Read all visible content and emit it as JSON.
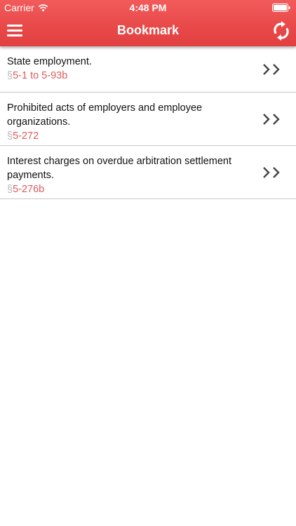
{
  "status_bar": {
    "carrier": "Carrier",
    "time": "4:48 PM",
    "wifi_icon": "wifi-icon",
    "battery_icon": "battery-icon"
  },
  "nav_bar": {
    "title": "Bookmark",
    "menu_icon": "hamburger-menu-icon",
    "refresh_icon": "refresh-icon"
  },
  "colors": {
    "header_red": "#e84848",
    "section_red": "#e05a5a",
    "section_mark_gray": "#b8b8b8",
    "chevron_gray": "#444444"
  },
  "bookmarks": [
    {
      "title": "State employment.",
      "section_mark": "§",
      "section": "5-1 to 5-93b",
      "chevron_icon": "double-chevron-right-icon"
    },
    {
      "title": "Prohibited acts of employers and employee organizations.",
      "section_mark": "§",
      "section": "5-272",
      "chevron_icon": "double-chevron-right-icon"
    },
    {
      "title": "Interest charges on overdue arbitration settlement payments.",
      "section_mark": "§",
      "section": "5-276b",
      "chevron_icon": "double-chevron-right-icon"
    }
  ]
}
